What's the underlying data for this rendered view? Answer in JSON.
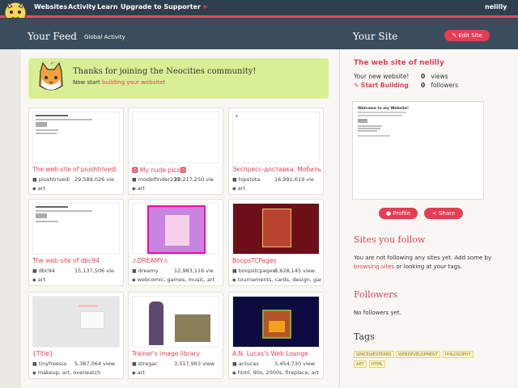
{
  "nav": {
    "websites": "Websites",
    "activity": "Activity",
    "learn": "Learn",
    "upgrade": "Upgrade to Supporter",
    "upgrade_icon": "♥",
    "user": "nelilly"
  },
  "feed": {
    "title": "Your Feed",
    "global": "Global Activity"
  },
  "welcome": {
    "message": "Thanks for joining the Neocities community!",
    "sub_prefix": "Now start ",
    "sub_link": "building your website",
    "sub_suffix": "!"
  },
  "cards": [
    {
      "name": "The web site of piushtrivedi",
      "user": "piushtrivedi",
      "views": "29,589,026 vie",
      "tags": "art"
    },
    {
      "name": "🅾 My nude pics🅾",
      "user": "modelfinder233",
      "views": "20,217,250 vie",
      "tags": "art"
    },
    {
      "name": "Экспресс-доставка. Мобильн",
      "user": "hipstota",
      "views": "16,991,619 vie",
      "tags": "art"
    },
    {
      "name": "The web site of dbc94",
      "user": "dbc94",
      "views": "15,137,506 vie",
      "tags": "art"
    },
    {
      "name": "⚠DREAMY⚠",
      "user": "dreamy",
      "views": "12,983,116 vie",
      "tags": "webcomic, games, music, art"
    },
    {
      "name": "BoopsTCPages",
      "user": "boopstcpages",
      "views": "8,628,145 view",
      "tags": "tournaments, cards, design, games..."
    },
    {
      "name": "{Title}",
      "user": "tinyfreesia",
      "views": "5,387,064 view",
      "tags": "makeup, art, overwatch"
    },
    {
      "name": "Trainer's image library",
      "user": "stregac",
      "views": "3,517,983 view",
      "tags": "art"
    },
    {
      "name": "A.N. Lucas's Web Lounge",
      "user": "anlucas",
      "views": "3,454,730 view",
      "tags": "html, 90s, 2000s, fireplace, art"
    }
  ],
  "site": {
    "title": "Your Site",
    "edit": "Edit Site",
    "name": "The web site of nelilly",
    "new_site": "Your new website!",
    "start": "Start Building",
    "views": "0",
    "views_label": "views",
    "followers": "0",
    "followers_label": "followers",
    "preview_title": "Welcome to my Website!"
  },
  "buttons": {
    "profile": "Profile",
    "share": "Share"
  },
  "follow": {
    "title": "Sites you follow",
    "text_a": "You are not following any sites yet. Add some by ",
    "link": "browsing sites",
    "text_b": " or looking at your tags."
  },
  "followers": {
    "title": "Followers",
    "text": "No followers yet."
  },
  "tags": {
    "title": "Tags",
    "items": [
      "SPACEWESTERNS",
      "WEBDEVELOPMENT",
      "PHILOSOPHY",
      "ART",
      "HTML"
    ]
  },
  "colors": {
    "accent": "#e33e55",
    "dark": "#2e3f4f"
  }
}
